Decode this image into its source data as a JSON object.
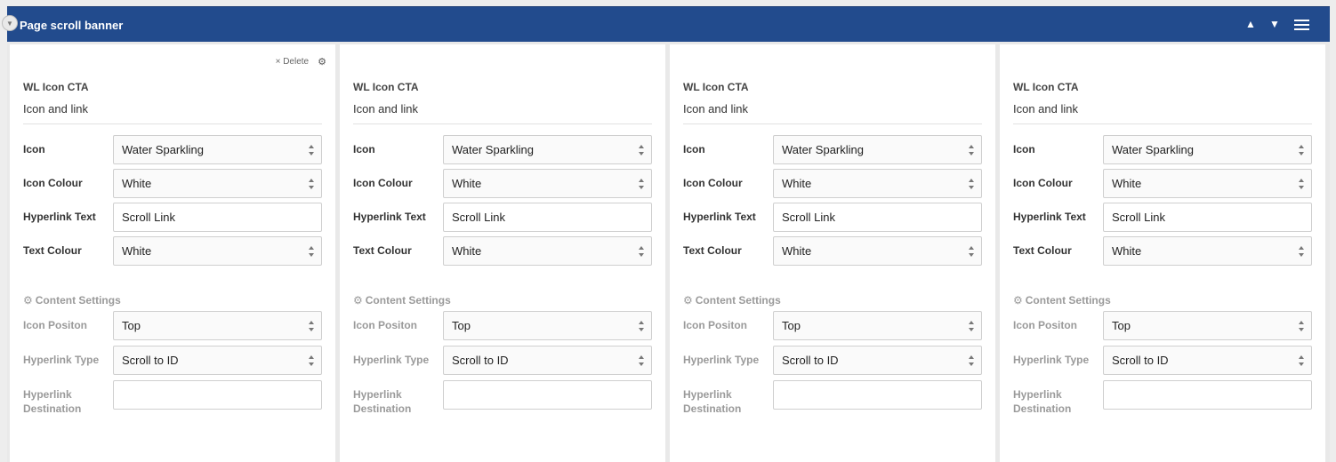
{
  "header": {
    "title": "Page scroll banner",
    "collapse_icon": "chevron-down-icon",
    "move_up_glyph": "▲",
    "move_down_glyph": "▼",
    "menu_icon": "hamburger-menu-icon",
    "bg_color": "#224b8d"
  },
  "card_actions": {
    "delete_label": "× Delete",
    "settings_icon": "gear-icon"
  },
  "section_icon": "cog-icon",
  "cards": [
    {
      "type": "WL Icon CTA",
      "description": "Icon and link",
      "fields": {
        "icon": {
          "label": "Icon",
          "value": "Water Sparkling"
        },
        "icon_colour": {
          "label": "Icon Colour",
          "value": "White"
        },
        "hyperlink_text": {
          "label": "Hyperlink Text",
          "value": "Scroll Link"
        },
        "text_colour": {
          "label": "Text Colour",
          "value": "White"
        }
      },
      "content_settings": {
        "heading": "Content Settings",
        "icon_position": {
          "label": "Icon Positon",
          "value": "Top"
        },
        "hyperlink_type": {
          "label": "Hyperlink Type",
          "value": "Scroll to ID"
        },
        "hyperlink_destination": {
          "label": "Hyperlink Destination",
          "value": ""
        }
      }
    },
    {
      "type": "WL Icon CTA",
      "description": "Icon and link",
      "fields": {
        "icon": {
          "label": "Icon",
          "value": "Water Sparkling"
        },
        "icon_colour": {
          "label": "Icon Colour",
          "value": "White"
        },
        "hyperlink_text": {
          "label": "Hyperlink Text",
          "value": "Scroll Link"
        },
        "text_colour": {
          "label": "Text Colour",
          "value": "White"
        }
      },
      "content_settings": {
        "heading": "Content Settings",
        "icon_position": {
          "label": "Icon Positon",
          "value": "Top"
        },
        "hyperlink_type": {
          "label": "Hyperlink Type",
          "value": "Scroll to ID"
        },
        "hyperlink_destination": {
          "label": "Hyperlink Destination",
          "value": ""
        }
      }
    },
    {
      "type": "WL Icon CTA",
      "description": "Icon and link",
      "fields": {
        "icon": {
          "label": "Icon",
          "value": "Water Sparkling"
        },
        "icon_colour": {
          "label": "Icon Colour",
          "value": "White"
        },
        "hyperlink_text": {
          "label": "Hyperlink Text",
          "value": "Scroll Link"
        },
        "text_colour": {
          "label": "Text Colour",
          "value": "White"
        }
      },
      "content_settings": {
        "heading": "Content Settings",
        "icon_position": {
          "label": "Icon Positon",
          "value": "Top"
        },
        "hyperlink_type": {
          "label": "Hyperlink Type",
          "value": "Scroll to ID"
        },
        "hyperlink_destination": {
          "label": "Hyperlink Destination",
          "value": ""
        }
      }
    },
    {
      "type": "WL Icon CTA",
      "description": "Icon and link",
      "fields": {
        "icon": {
          "label": "Icon",
          "value": "Water Sparkling"
        },
        "icon_colour": {
          "label": "Icon Colour",
          "value": "White"
        },
        "hyperlink_text": {
          "label": "Hyperlink Text",
          "value": "Scroll Link"
        },
        "text_colour": {
          "label": "Text Colour",
          "value": "White"
        }
      },
      "content_settings": {
        "heading": "Content Settings",
        "icon_position": {
          "label": "Icon Positon",
          "value": "Top"
        },
        "hyperlink_type": {
          "label": "Hyperlink Type",
          "value": "Scroll to ID"
        },
        "hyperlink_destination": {
          "label": "Hyperlink Destination",
          "value": ""
        }
      }
    }
  ]
}
